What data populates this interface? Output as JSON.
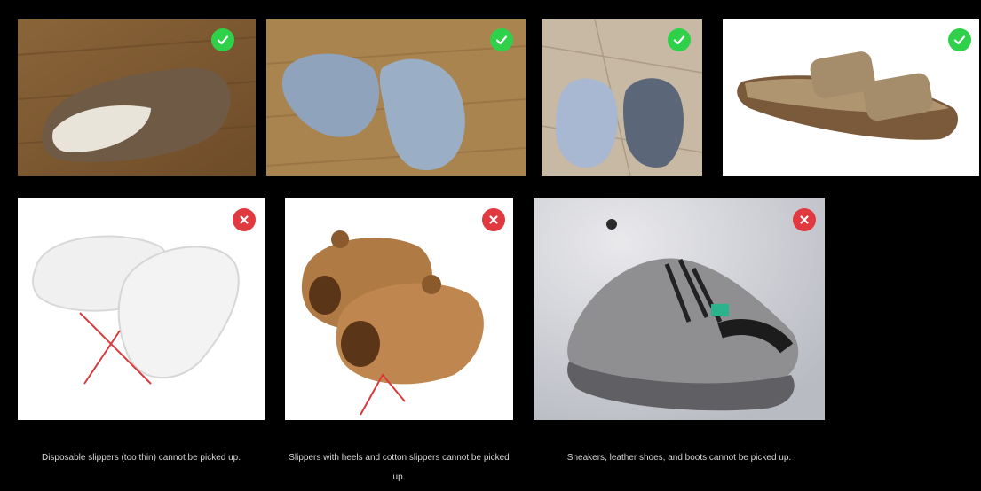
{
  "tiles": [
    {
      "subject": "Brown suede clog slipper on wooden floor",
      "status": "allowed",
      "badge_icon": "check-icon"
    },
    {
      "subject": "Pair of light blue slides on wooden floor",
      "status": "allowed",
      "badge_icon": "check-icon"
    },
    {
      "subject": "Blue and gray house slippers on tiled floor",
      "status": "allowed",
      "badge_icon": "check-icon"
    },
    {
      "subject": "Tan two-strap cork sandal",
      "status": "allowed",
      "badge_icon": "check-icon"
    },
    {
      "subject": "White disposable hotel slippers crossed out",
      "status": "not-allowed",
      "badge_icon": "close-icon"
    },
    {
      "subject": "Brown plush capybara slippers crossed out",
      "status": "not-allowed",
      "badge_icon": "close-icon"
    },
    {
      "subject": "Gray chunky sneaker",
      "status": "not-allowed",
      "badge_icon": "close-icon"
    }
  ],
  "captions": {
    "disposable": "Disposable slippers (too thin) cannot be picked up.",
    "cotton": "Slippers with heels and cotton slippers cannot be picked up.",
    "sneakers": "Sneakers, leather shoes, and boots cannot be picked up."
  },
  "colors": {
    "allowed_badge": "#2fd14a",
    "not_allowed_badge": "#e0393f",
    "background": "#000000"
  }
}
